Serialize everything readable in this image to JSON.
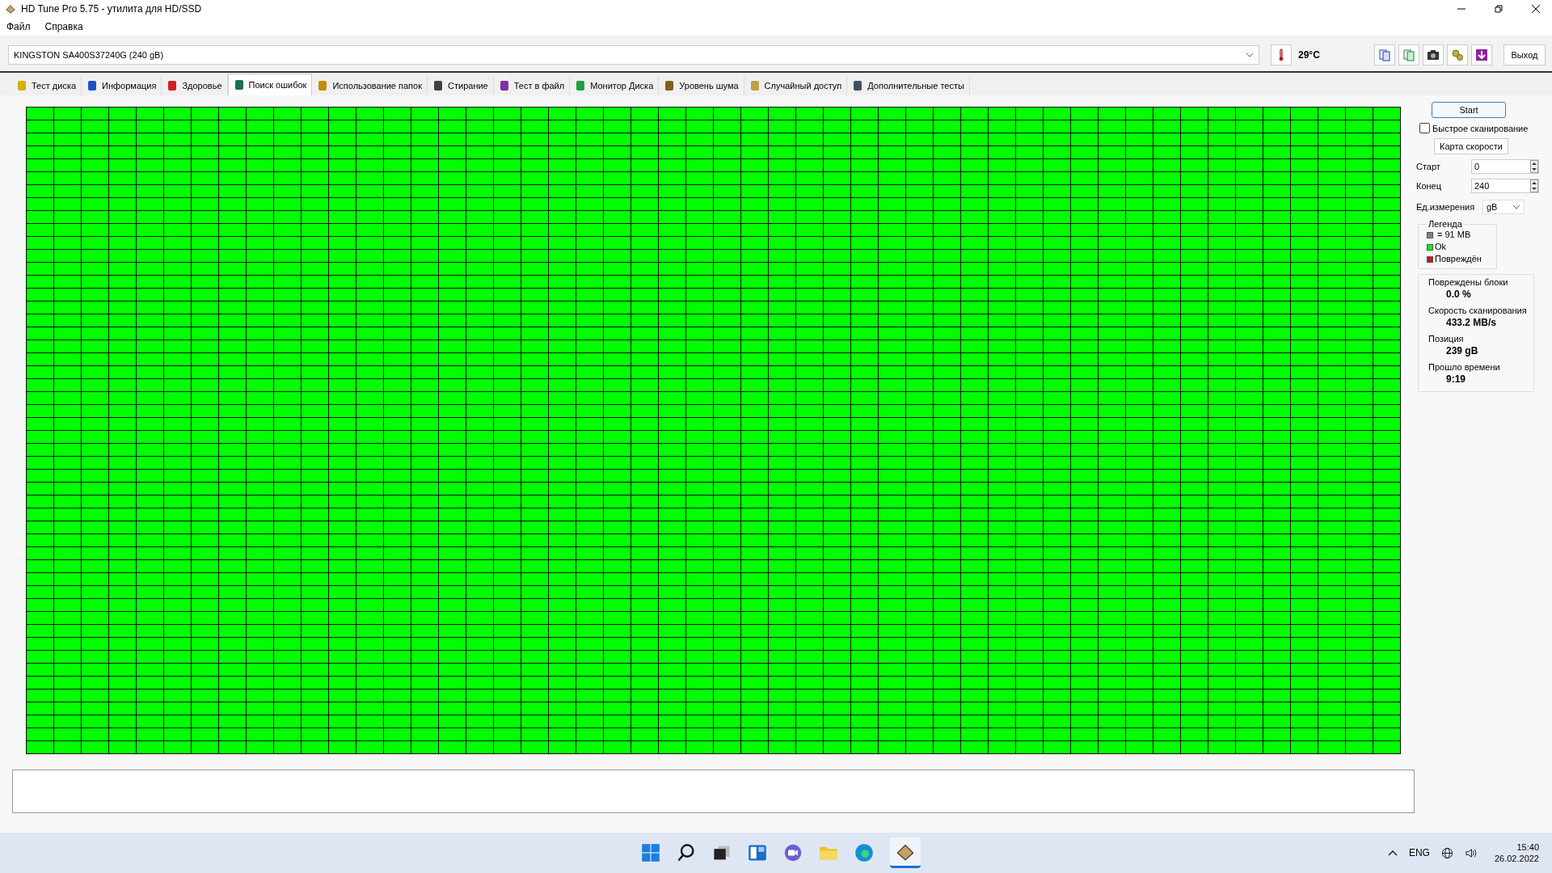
{
  "window": {
    "title": "HD Tune Pro 5.75 - утилита для HD/SSD"
  },
  "menu": [
    {
      "label": "Файл"
    },
    {
      "label": "Справка"
    }
  ],
  "drive": {
    "value": "KINGSTON SA400S37240G (240 gB)"
  },
  "temperature": "29°C",
  "exit_button": "Выход",
  "tabs": [
    {
      "label": "Тест диска",
      "selected": false
    },
    {
      "label": "Информация",
      "selected": false
    },
    {
      "label": "Здоровье",
      "selected": false
    },
    {
      "label": "Поиск ошибок",
      "selected": true
    },
    {
      "label": "Использование папок",
      "selected": false
    },
    {
      "label": "Стирание",
      "selected": false
    },
    {
      "label": "Тест в файл",
      "selected": false
    },
    {
      "label": "Монитор Диска",
      "selected": false
    },
    {
      "label": "Уровень шума",
      "selected": false
    },
    {
      "label": "Случайный доступ",
      "selected": false
    },
    {
      "label": "Дополнительные  тесты",
      "selected": false
    }
  ],
  "panel": {
    "start_button": "Start",
    "quick_scan": {
      "label": "Быстрое сканирование",
      "checked": false
    },
    "speed_map_button": "Карта скорости",
    "start": {
      "label": "Старт",
      "value": "0"
    },
    "end": {
      "label": "Конец",
      "value": "240"
    },
    "unit": {
      "label": "Ед.измерения",
      "value": "gB"
    },
    "legend": {
      "title": "Легенда",
      "items": [
        {
          "kind": "size",
          "label": "= 91 MB",
          "color": "#808080"
        },
        {
          "kind": "ok",
          "label": "Ok",
          "color": "#00ff00"
        },
        {
          "kind": "damaged",
          "label": "Повреждён",
          "color": "#d01818"
        }
      ]
    },
    "stats": [
      {
        "label": "Повреждены блоки",
        "value": "0.0 %"
      },
      {
        "label": "Скорость сканирования",
        "value": "433.2 MB/s"
      },
      {
        "label": "Позиция",
        "value": "239 gB"
      },
      {
        "label": "Прошло времени",
        "value": "9:19"
      }
    ]
  },
  "taskbar": {
    "language": "ENG",
    "time": "15:40",
    "date": "26.02.2022"
  }
}
